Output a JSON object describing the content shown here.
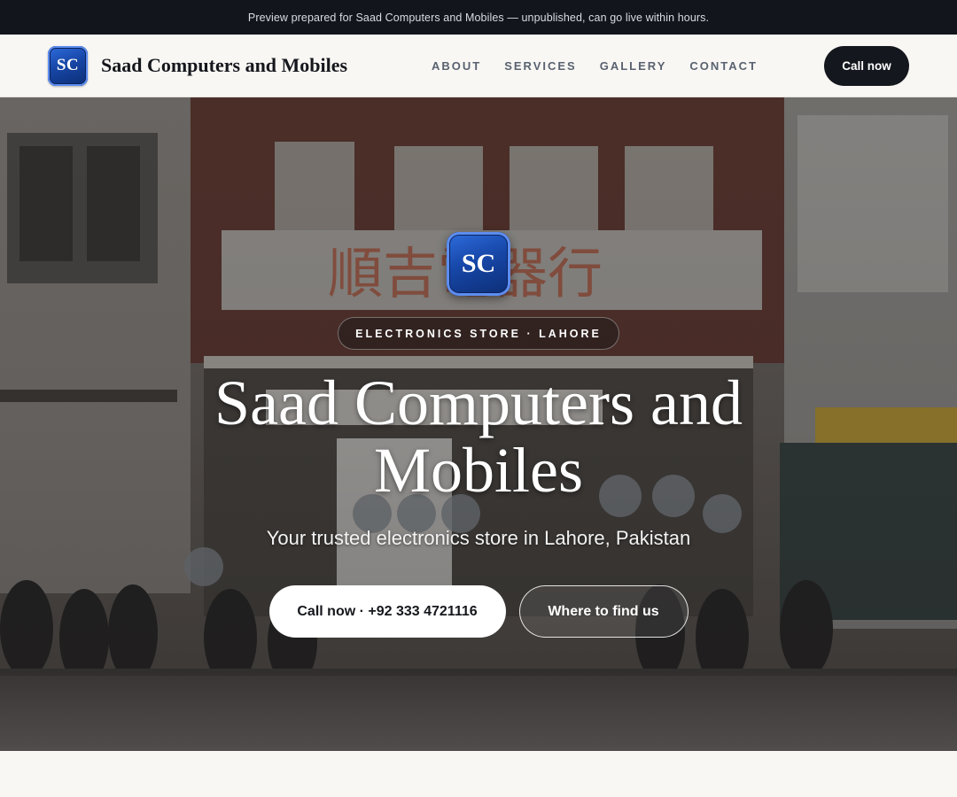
{
  "announcement": "Preview prepared for Saad Computers and Mobiles — unpublished, can go live within hours.",
  "brand": {
    "logo_text": "SC",
    "name": "Saad Computers and Mobiles"
  },
  "nav": {
    "items": [
      "ABOUT",
      "SERVICES",
      "GALLERY",
      "CONTACT"
    ]
  },
  "header_cta": "Call now",
  "hero": {
    "logo_text": "SC",
    "badge": "ELECTRONICS STORE · LAHORE",
    "title": "Saad Computers and Mobiles",
    "subtitle": "Your trusted electronics store in Lahore, Pakistan",
    "primary_cta": "Call now · +92 333 4721116",
    "secondary_cta": "Where to find us"
  },
  "colors": {
    "topbar_bg": "#12151b",
    "header_bg": "#f8f7f4",
    "brand_blue": "#1747a8",
    "dark_button": "#14171d"
  }
}
